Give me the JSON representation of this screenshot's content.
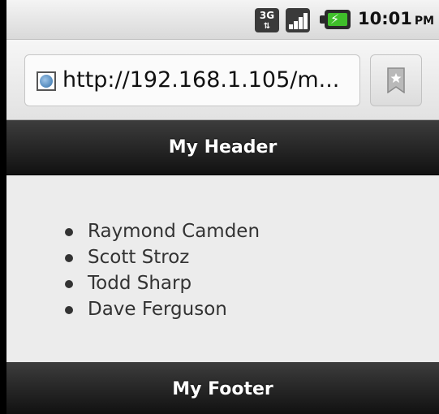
{
  "status_bar": {
    "network_label": "3G",
    "network_arrows": "⇅",
    "time": "10:01",
    "ampm": "PM",
    "icons": [
      "3g-icon",
      "signal-icon",
      "battery-charging-icon"
    ]
  },
  "browser": {
    "url": "http://192.168.1.105/m...",
    "icons": [
      "globe-icon",
      "bookmark-icon"
    ]
  },
  "page": {
    "header_title": "My Header",
    "list_items": [
      "Raymond Camden",
      "Scott Stroz",
      "Todd Sharp",
      "Dave Ferguson"
    ],
    "footer_title": "My Footer"
  },
  "colors": {
    "bar_background": "#1e1e1e",
    "content_background": "#ececec",
    "battery_green": "#3fbf2a"
  }
}
